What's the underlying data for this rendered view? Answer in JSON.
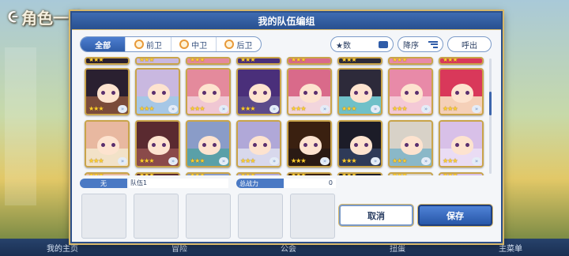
{
  "background": {
    "title": "角色一览",
    "tabbar": [
      "我的主页",
      "冒险",
      "公会",
      "扭蛋",
      "主菜单"
    ]
  },
  "dialog": {
    "title": "我的队伍编组"
  },
  "filters": {
    "tabs": [
      {
        "label": "全部",
        "active": true
      },
      {
        "label": "前卫",
        "active": false
      },
      {
        "label": "中卫",
        "active": false
      },
      {
        "label": "后卫",
        "active": false
      }
    ],
    "sort_field": "★数",
    "sort_order": "降序",
    "callout_button": "呼出"
  },
  "roster": {
    "star_glyph": "★★★",
    "rank_glyph": "»",
    "rows": [
      [
        {
          "hair": "#2a2030",
          "bg": "#7a4b3a"
        },
        {
          "hair": "#c9b8e0",
          "bg": "#a6c7e6"
        },
        {
          "hair": "#e48a9c",
          "bg": "#f0c7d3"
        },
        {
          "hair": "#4a2f7a",
          "bg": "#5c4a8a"
        },
        {
          "hair": "#d96a8a",
          "bg": "#f2d5dc"
        },
        {
          "hair": "#2d2a3a",
          "bg": "#6fc0c8"
        },
        {
          "hair": "#e88aa8",
          "bg": "#f4c9d6"
        },
        {
          "hair": "#d9385a",
          "bg": "#f5d0b8"
        }
      ],
      [
        {
          "hair": "#e8b8a0",
          "bg": "#f2e2c8"
        },
        {
          "hair": "#5a2a30",
          "bg": "#8a4a4a"
        },
        {
          "hair": "#8a9cc8",
          "bg": "#5aa0a8"
        },
        {
          "hair": "#b0a8d8",
          "bg": "#d8d8ec"
        },
        {
          "hair": "#3a2010",
          "bg": "#2a1a14"
        },
        {
          "hair": "#1c1c28",
          "bg": "#2e3a58"
        },
        {
          "hair": "#d8d2c8",
          "bg": "#8ab8c8"
        },
        {
          "hair": "#d8c0e8",
          "bg": "#eadcf4"
        },
        {
          "hair": "#d24a3a",
          "bg": "#f2c4a4"
        }
      ]
    ]
  },
  "team": {
    "label": "无",
    "name": "队伍1",
    "power_label": "总战力",
    "power_value": "0",
    "slot_count": 5
  },
  "buttons": {
    "cancel": "取消",
    "save": "保存"
  }
}
